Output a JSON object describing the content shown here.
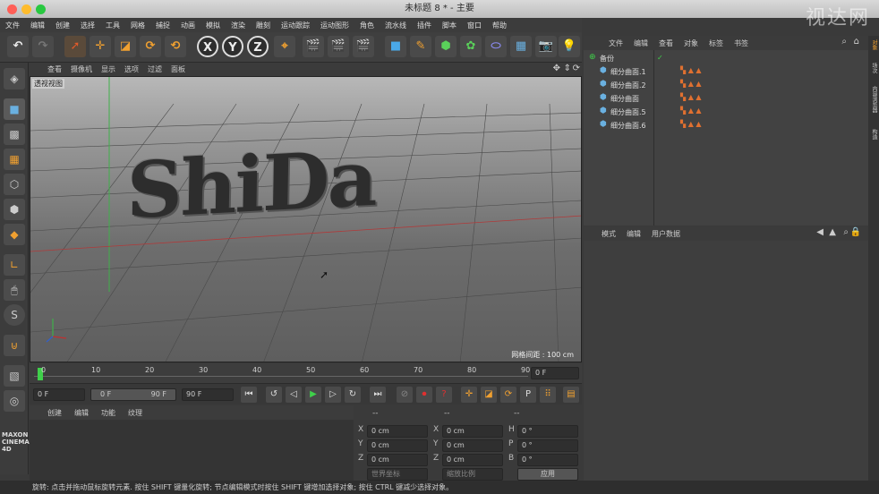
{
  "window": {
    "title": "未标题 8 * - 主要",
    "watermark": "视达网"
  },
  "menubar": [
    "文件",
    "编辑",
    "创建",
    "选择",
    "工具",
    "网格",
    "捕捉",
    "动画",
    "模拟",
    "渲染",
    "雕刻",
    "运动跟踪",
    "运动图形",
    "角色",
    "流水线",
    "插件",
    "脚本",
    "窗口",
    "帮助"
  ],
  "toolbar": {
    "axes": [
      "X",
      "Y",
      "Z"
    ]
  },
  "viewport": {
    "menu": [
      "查看",
      "摄像机",
      "显示",
      "选项",
      "过滤",
      "面板"
    ],
    "label": "透视视图",
    "text3d": "ShiDa",
    "grid_info": "网格间距 : 100 cm"
  },
  "timeline": {
    "ticks": [
      "0",
      "10",
      "20",
      "30",
      "40",
      "50",
      "60",
      "70",
      "80",
      "90"
    ],
    "current_frame": "0 F",
    "start": "0 F",
    "range_start": "0 F",
    "range_end": "90 F",
    "end": "90 F"
  },
  "material": {
    "menu": [
      "创建",
      "编辑",
      "功能",
      "纹理"
    ]
  },
  "coords": {
    "headers": [
      "--",
      "--",
      "--"
    ],
    "rows": [
      {
        "a": "X",
        "av": "0 cm",
        "b": "X",
        "bv": "0 cm",
        "c": "H",
        "cv": "0 °"
      },
      {
        "a": "Y",
        "av": "0 cm",
        "b": "Y",
        "bv": "0 cm",
        "c": "P",
        "cv": "0 °"
      },
      {
        "a": "Z",
        "av": "0 cm",
        "b": "Z",
        "bv": "0 cm",
        "c": "B",
        "cv": "0 °"
      }
    ],
    "mode1": "世界坐标",
    "mode2": "缩放比例",
    "apply": "应用"
  },
  "objects": {
    "menu": [
      "文件",
      "编辑",
      "查看",
      "对象",
      "标签",
      "书签"
    ],
    "items": [
      "备份",
      "细分曲面.1",
      "细分曲面.2",
      "细分曲面",
      "细分曲面.5",
      "细分曲面.6"
    ]
  },
  "attributes": {
    "menu": [
      "模式",
      "编辑",
      "用户数据"
    ]
  },
  "right_tabs": [
    "对象",
    "场次",
    "内容浏览器",
    "构造"
  ],
  "brand": [
    "MAXON",
    "CINEMA 4D"
  ],
  "status": "旋转: 点击并拖动鼠标旋转元素. 按住 SHIFT 键量化旋转; 节点编辑模式时按住 SHIFT 键增加选择对象; 按住 CTRL 键减少选择对象。"
}
